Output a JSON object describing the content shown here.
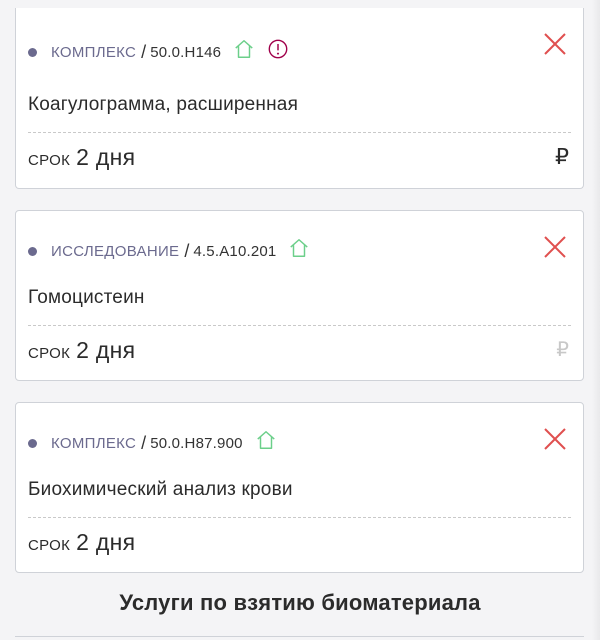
{
  "cart": {
    "items": [
      {
        "type": "КОМПЛЕКС",
        "code": "50.0.H146",
        "name": "Коагулограмма, расширенная",
        "term_label": "СРОК",
        "term_value": "2 дня",
        "price_symbol": "₽",
        "icons": [
          "home-icon",
          "exclamation-circle-icon",
          "close-icon"
        ]
      },
      {
        "type": "ИССЛЕДОВАНИЕ",
        "code": "4.5.A10.201",
        "name": "Гомоцистеин",
        "term_label": "СРОК",
        "term_value": "2 дня",
        "price_symbol": "₽",
        "icons": [
          "home-icon",
          "close-icon"
        ]
      },
      {
        "type": "КОМПЛЕКС",
        "code": "50.0.H87.900",
        "name": "Биохимический анализ крови",
        "term_label": "СРОК",
        "term_value": "2 дня",
        "icons": [
          "home-icon",
          "close-icon"
        ]
      }
    ]
  },
  "section": {
    "title": "Услуги по взятию биоматериала"
  },
  "colors": {
    "type_label": "#6b6a8e",
    "home_icon": "#6ccf8a",
    "warning_icon": "#a0004b",
    "close_icon": "#e0504f",
    "card_border": "#cfd2d8"
  }
}
